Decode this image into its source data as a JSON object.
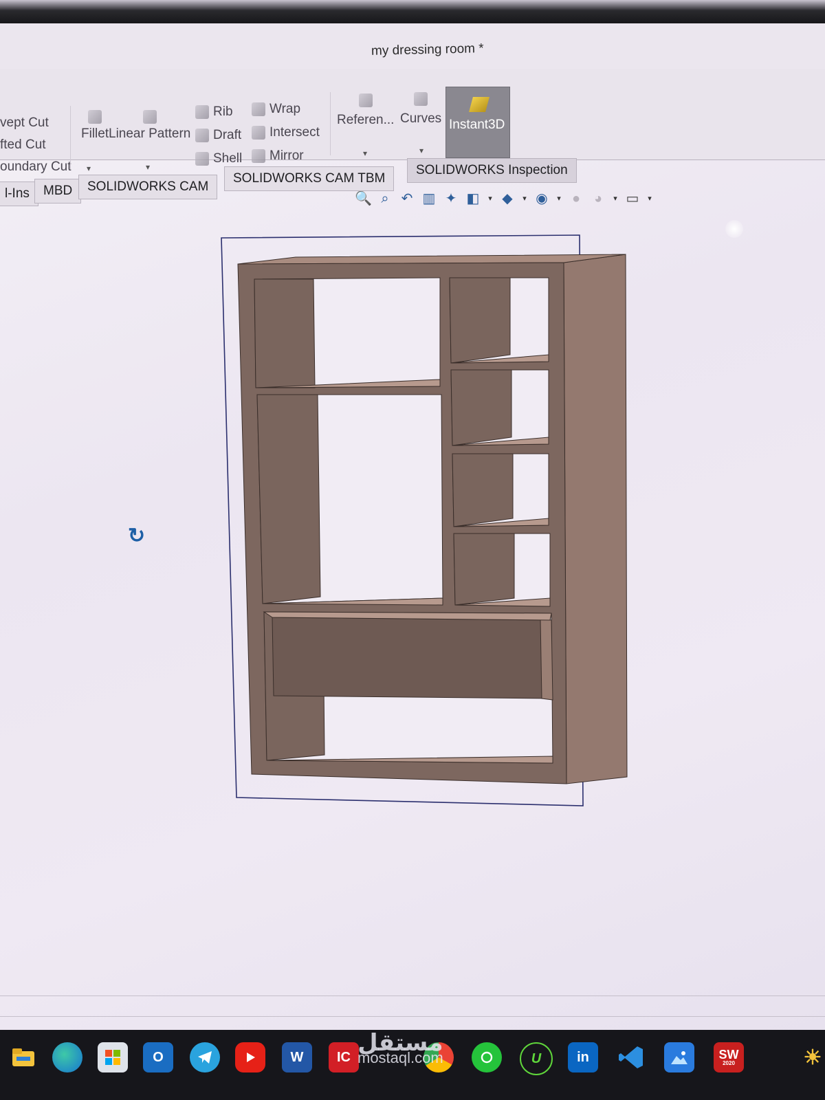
{
  "window": {
    "title": "my dressing room *"
  },
  "ribbon": {
    "items": [
      {
        "label": "vept Cut",
        "icon": "swept-cut-icon"
      },
      {
        "label": "fted Cut",
        "icon": "lofted-cut-icon"
      },
      {
        "label": "oundary Cut",
        "icon": "boundary-cut-icon"
      },
      {
        "label": "Fillet",
        "icon": "fillet-icon"
      },
      {
        "label": "Linear Pattern",
        "icon": "linear-pattern-icon"
      },
      {
        "label": "Rib",
        "icon": "rib-icon"
      },
      {
        "label": "Draft",
        "icon": "draft-icon"
      },
      {
        "label": "Shell",
        "icon": "shell-icon"
      },
      {
        "label": "Wrap",
        "icon": "wrap-icon"
      },
      {
        "label": "Intersect",
        "icon": "intersect-icon"
      },
      {
        "label": "Mirror",
        "icon": "mirror-icon"
      },
      {
        "label": "Referen...",
        "icon": "reference-geometry-icon"
      },
      {
        "label": "Curves",
        "icon": "curves-icon"
      },
      {
        "label": "Instant3D",
        "icon": "instant3d-icon",
        "active": true
      }
    ]
  },
  "tabs": [
    {
      "label": "l-Ins"
    },
    {
      "label": "MBD"
    },
    {
      "label": "SOLIDWORKS CAM"
    },
    {
      "label": "SOLIDWORKS CAM TBM"
    },
    {
      "label": "SOLIDWORKS Inspection"
    }
  ],
  "taskbar": {
    "apps": [
      {
        "name": "file-explorer",
        "label": ""
      },
      {
        "name": "edge",
        "label": ""
      },
      {
        "name": "microsoft-store",
        "label": ""
      },
      {
        "name": "outlook",
        "label": "O"
      },
      {
        "name": "telegram",
        "label": ""
      },
      {
        "name": "youtube",
        "label": ""
      },
      {
        "name": "word",
        "label": "W"
      },
      {
        "name": "ic-app",
        "label": "IC"
      },
      {
        "name": "chrome",
        "label": ""
      },
      {
        "name": "whatsapp",
        "label": ""
      },
      {
        "name": "upwork",
        "label": "U"
      },
      {
        "name": "linkedin",
        "label": "in"
      },
      {
        "name": "vscode",
        "label": ""
      },
      {
        "name": "photos",
        "label": ""
      },
      {
        "name": "solidworks",
        "label": "SW",
        "sub": "2020"
      }
    ],
    "watermark": {
      "arabic": "مستقل",
      "latin": "mostaql.com"
    }
  },
  "colors": {
    "wood_front": "#7d675f",
    "wood_side": "#94796f",
    "wood_top": "#a98c80",
    "wood_inner_back": "#6e5a53",
    "selection_box": "#2b2f6e"
  }
}
